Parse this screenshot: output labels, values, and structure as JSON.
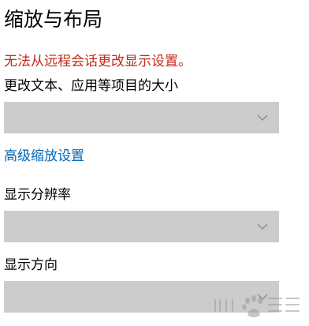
{
  "page": {
    "title": "缩放与布局",
    "warning": "无法从远程会话更改显示设置。",
    "scale_label": "更改文本、应用等项目的大小",
    "scale_value": "",
    "advanced_link": "高级缩放设置",
    "resolution_label": "显示分辨率",
    "resolution_value": "",
    "orientation_label": "显示方向",
    "orientation_value": ""
  },
  "icons": {
    "chevron": "chevron-down-icon"
  },
  "colors": {
    "warning": "#c42b1c",
    "link": "#0067b8",
    "dropdown_disabled": "#cccccc"
  }
}
